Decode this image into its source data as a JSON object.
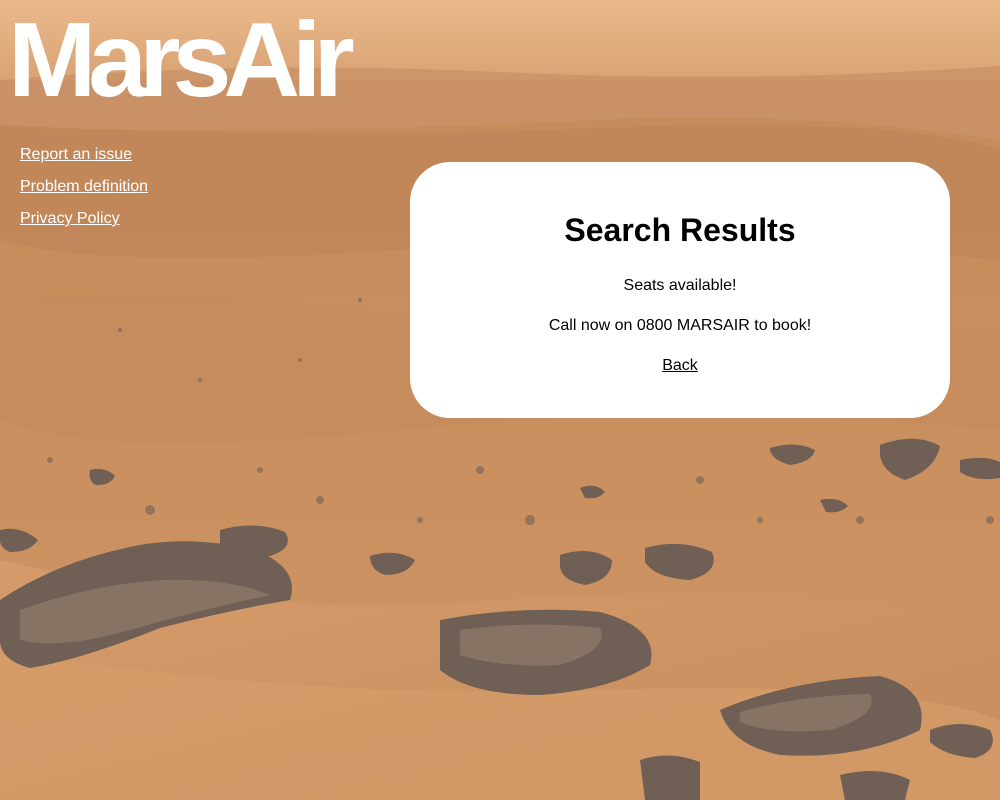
{
  "brand": {
    "logo_text": "MarsAir",
    "logo_color": "#ffffff"
  },
  "nav": {
    "links": [
      {
        "label": "Report an issue"
      },
      {
        "label": "Problem definition"
      },
      {
        "label": "Privacy Policy"
      }
    ]
  },
  "results": {
    "heading": "Search Results",
    "message": "Seats available!",
    "call_to_action": "Call now on 0800 MARSAIR to book!",
    "back_label": "Back"
  },
  "theme": {
    "sky_color": "#e8b483",
    "ground_color": "#c98e5c",
    "rock_color": "#6f5f55",
    "card_background": "#ffffff"
  }
}
